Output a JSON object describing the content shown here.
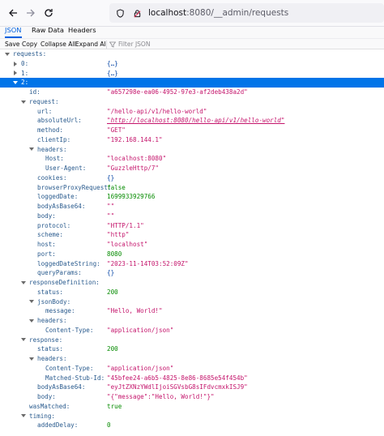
{
  "browser": {
    "url_host": "localhost",
    "url_path": ":8080/__admin/requests"
  },
  "viewer": {
    "tabs": [
      "JSON",
      "Raw Data",
      "Headers"
    ],
    "actions": [
      "Save",
      "Copy",
      "Collapse All",
      "Expand All"
    ],
    "filter_placeholder": "Filter JSON"
  },
  "colors": {
    "accent": "#0060df",
    "selected_row": "#0074e8",
    "key": "#2a5b8e",
    "string": "#c4146b",
    "number": "#058b00"
  },
  "tree": [
    {
      "depth": 0,
      "toggle": "open",
      "key": "requests:",
      "value": "",
      "type": ""
    },
    {
      "depth": 1,
      "toggle": "closed",
      "key": "0:",
      "value": "{…}",
      "type": "obj"
    },
    {
      "depth": 1,
      "toggle": "closed",
      "key": "1:",
      "value": "{…}",
      "type": "obj"
    },
    {
      "depth": 1,
      "toggle": "open",
      "key": "2:",
      "value": "",
      "type": "",
      "selected": true
    },
    {
      "depth": 2,
      "toggle": "",
      "key": "id:",
      "value": "\"a657298e-ea06-4952-97e3-af2deb438a2d\"",
      "type": "str"
    },
    {
      "depth": 2,
      "toggle": "open",
      "key": "request:",
      "value": "",
      "type": ""
    },
    {
      "depth": 3,
      "toggle": "",
      "key": "url:",
      "value": "\"/hello-api/v1/hello-world\"",
      "type": "str"
    },
    {
      "depth": 3,
      "toggle": "",
      "key": "absoluteUrl:",
      "value": "\"http://localhost:8080/hello-api/v1/hello-world\"",
      "type": "url"
    },
    {
      "depth": 3,
      "toggle": "",
      "key": "method:",
      "value": "\"GET\"",
      "type": "str"
    },
    {
      "depth": 3,
      "toggle": "",
      "key": "clientIp:",
      "value": "\"192.168.144.1\"",
      "type": "str"
    },
    {
      "depth": 3,
      "toggle": "open",
      "key": "headers:",
      "value": "",
      "type": ""
    },
    {
      "depth": 4,
      "toggle": "",
      "key": "Host:",
      "value": "\"localhost:8080\"",
      "type": "str"
    },
    {
      "depth": 4,
      "toggle": "",
      "key": "User-Agent:",
      "value": "\"GuzzleHttp/7\"",
      "type": "str"
    },
    {
      "depth": 3,
      "toggle": "",
      "key": "cookies:",
      "value": "{}",
      "type": "obj"
    },
    {
      "depth": 3,
      "toggle": "",
      "key": "browserProxyRequest:",
      "value": "false",
      "type": "bool"
    },
    {
      "depth": 3,
      "toggle": "",
      "key": "loggedDate:",
      "value": "1699933929766",
      "type": "num"
    },
    {
      "depth": 3,
      "toggle": "",
      "key": "bodyAsBase64:",
      "value": "\"\"",
      "type": "str"
    },
    {
      "depth": 3,
      "toggle": "",
      "key": "body:",
      "value": "\"\"",
      "type": "str"
    },
    {
      "depth": 3,
      "toggle": "",
      "key": "protocol:",
      "value": "\"HTTP/1.1\"",
      "type": "str"
    },
    {
      "depth": 3,
      "toggle": "",
      "key": "scheme:",
      "value": "\"http\"",
      "type": "str"
    },
    {
      "depth": 3,
      "toggle": "",
      "key": "host:",
      "value": "\"localhost\"",
      "type": "str"
    },
    {
      "depth": 3,
      "toggle": "",
      "key": "port:",
      "value": "8080",
      "type": "num"
    },
    {
      "depth": 3,
      "toggle": "",
      "key": "loggedDateString:",
      "value": "\"2023-11-14T03:52:09Z\"",
      "type": "str"
    },
    {
      "depth": 3,
      "toggle": "",
      "key": "queryParams:",
      "value": "{}",
      "type": "obj"
    },
    {
      "depth": 2,
      "toggle": "open",
      "key": "responseDefinition:",
      "value": "",
      "type": ""
    },
    {
      "depth": 3,
      "toggle": "",
      "key": "status:",
      "value": "200",
      "type": "num"
    },
    {
      "depth": 3,
      "toggle": "open",
      "key": "jsonBody:",
      "value": "",
      "type": ""
    },
    {
      "depth": 4,
      "toggle": "",
      "key": "message:",
      "value": "\"Hello, World!\"",
      "type": "str"
    },
    {
      "depth": 3,
      "toggle": "open",
      "key": "headers:",
      "value": "",
      "type": ""
    },
    {
      "depth": 4,
      "toggle": "",
      "key": "Content-Type:",
      "value": "\"application/json\"",
      "type": "str"
    },
    {
      "depth": 2,
      "toggle": "open",
      "key": "response:",
      "value": "",
      "type": ""
    },
    {
      "depth": 3,
      "toggle": "",
      "key": "status:",
      "value": "200",
      "type": "num"
    },
    {
      "depth": 3,
      "toggle": "open",
      "key": "headers:",
      "value": "",
      "type": ""
    },
    {
      "depth": 4,
      "toggle": "",
      "key": "Content-Type:",
      "value": "\"application/json\"",
      "type": "str"
    },
    {
      "depth": 4,
      "toggle": "",
      "key": "Matched-Stub-Id:",
      "value": "\"45bfee24-a6b5-4825-8e86-8685e54f454b\"",
      "type": "str"
    },
    {
      "depth": 3,
      "toggle": "",
      "key": "bodyAsBase64:",
      "value": "\"eyJtZXNzYWdlIjoiSGVsbG8sIFdvcmxkISJ9\"",
      "type": "str"
    },
    {
      "depth": 3,
      "toggle": "",
      "key": "body:",
      "value": "\"{\"message\":\"Hello, World!\"}\"",
      "type": "str"
    },
    {
      "depth": 2,
      "toggle": "",
      "key": "wasMatched:",
      "value": "true",
      "type": "bool"
    },
    {
      "depth": 2,
      "toggle": "open",
      "key": "timing:",
      "value": "",
      "type": ""
    },
    {
      "depth": 3,
      "toggle": "",
      "key": "addedDelay:",
      "value": "0",
      "type": "num"
    }
  ]
}
